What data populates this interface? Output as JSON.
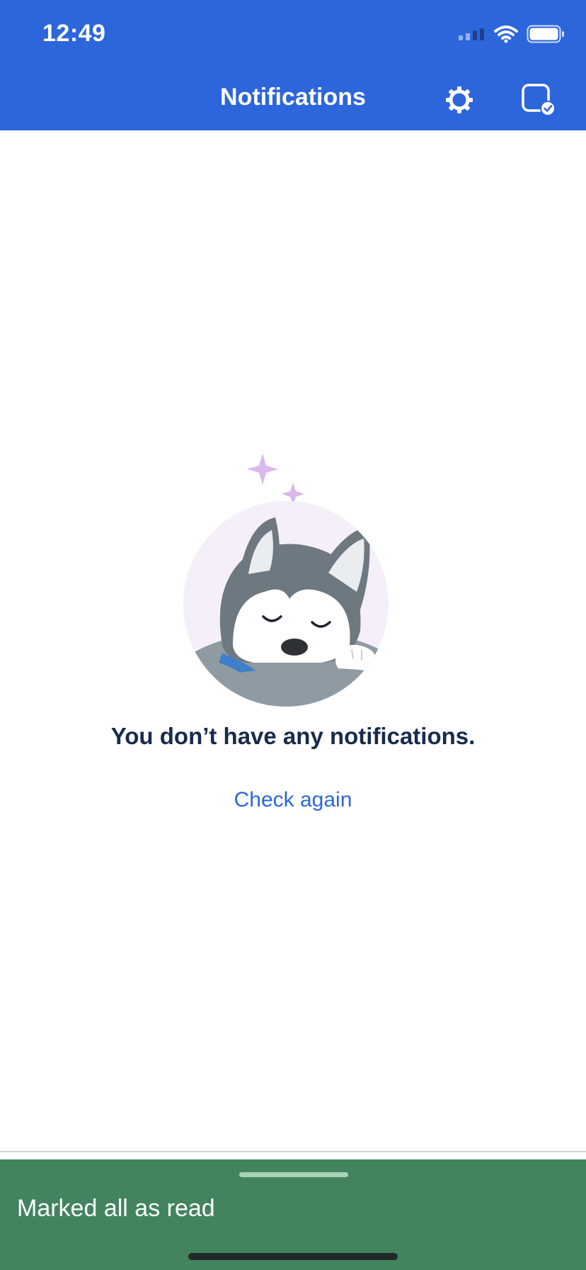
{
  "status_bar": {
    "time": "12:49"
  },
  "nav": {
    "title": "Notifications",
    "settings_icon": "gear-icon",
    "mark_all_read_icon": "square-check-icon"
  },
  "empty_state": {
    "illustration": "sleeping-husky",
    "message": "You don’t have any notifications.",
    "action_label": "Check again"
  },
  "toast": {
    "message": "Marked all as read"
  },
  "colors": {
    "header": "#2d66db",
    "link": "#2d66db",
    "toast": "#42845e",
    "text_primary": "#172b4d"
  }
}
